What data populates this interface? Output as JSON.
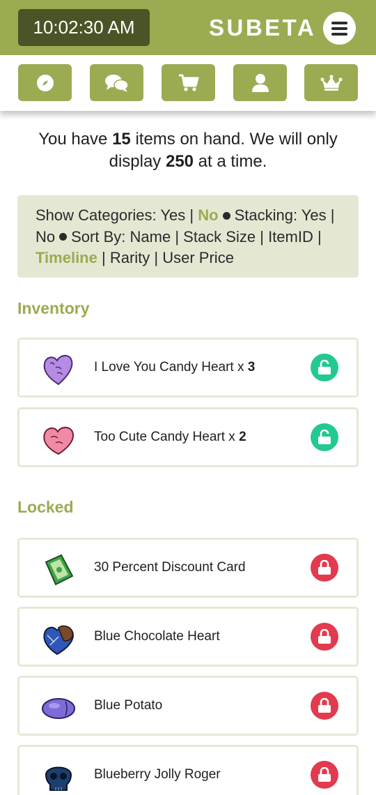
{
  "header": {
    "clock": "10:02:30 AM",
    "brand": "SUBETA",
    "colors": {
      "brand_green": "#9aab52",
      "clock_bg": "#4b5426"
    }
  },
  "nav": [
    {
      "icon": "compass-icon"
    },
    {
      "icon": "chat-bubbles-icon"
    },
    {
      "icon": "shopping-cart-icon"
    },
    {
      "icon": "user-icon"
    },
    {
      "icon": "crown-icon"
    }
  ],
  "intro": {
    "part1": "You have ",
    "count": "15",
    "part2": " items on hand. We will only display ",
    "limit": "250",
    "part3": " at a time."
  },
  "filters": {
    "categories_label": "Show Categories:",
    "categories_yes": "Yes",
    "categories_no": "No",
    "stacking_label": "Stacking:",
    "stacking_yes": "Yes",
    "stacking_no": "No",
    "sort_label": "Sort By:",
    "sort_name": "Name",
    "sort_stack": "Stack Size",
    "sort_itemid": "ItemID",
    "sort_timeline": "Timeline",
    "sort_rarity": "Rarity",
    "sort_price": "User Price",
    "separator": "|"
  },
  "inventory": {
    "title": "Inventory",
    "items": [
      {
        "name": "I Love You Candy Heart",
        "qty_prefix": " x ",
        "qty": "3",
        "lock": "unlocked",
        "icon": "purple-candy-heart-icon"
      },
      {
        "name": "Too Cute Candy Heart",
        "qty_prefix": " x ",
        "qty": "2",
        "lock": "unlocked",
        "icon": "pink-candy-heart-icon"
      }
    ]
  },
  "locked": {
    "title": "Locked",
    "items": [
      {
        "name": "30 Percent Discount Card",
        "lock": "locked",
        "icon": "discount-card-icon"
      },
      {
        "name": "Blue Chocolate Heart",
        "lock": "locked",
        "icon": "blue-chocolate-heart-icon"
      },
      {
        "name": "Blue Potato",
        "lock": "locked",
        "icon": "blue-potato-icon"
      },
      {
        "name": "Blueberry Jolly Roger",
        "lock": "locked",
        "icon": "blueberry-skull-icon"
      }
    ]
  }
}
